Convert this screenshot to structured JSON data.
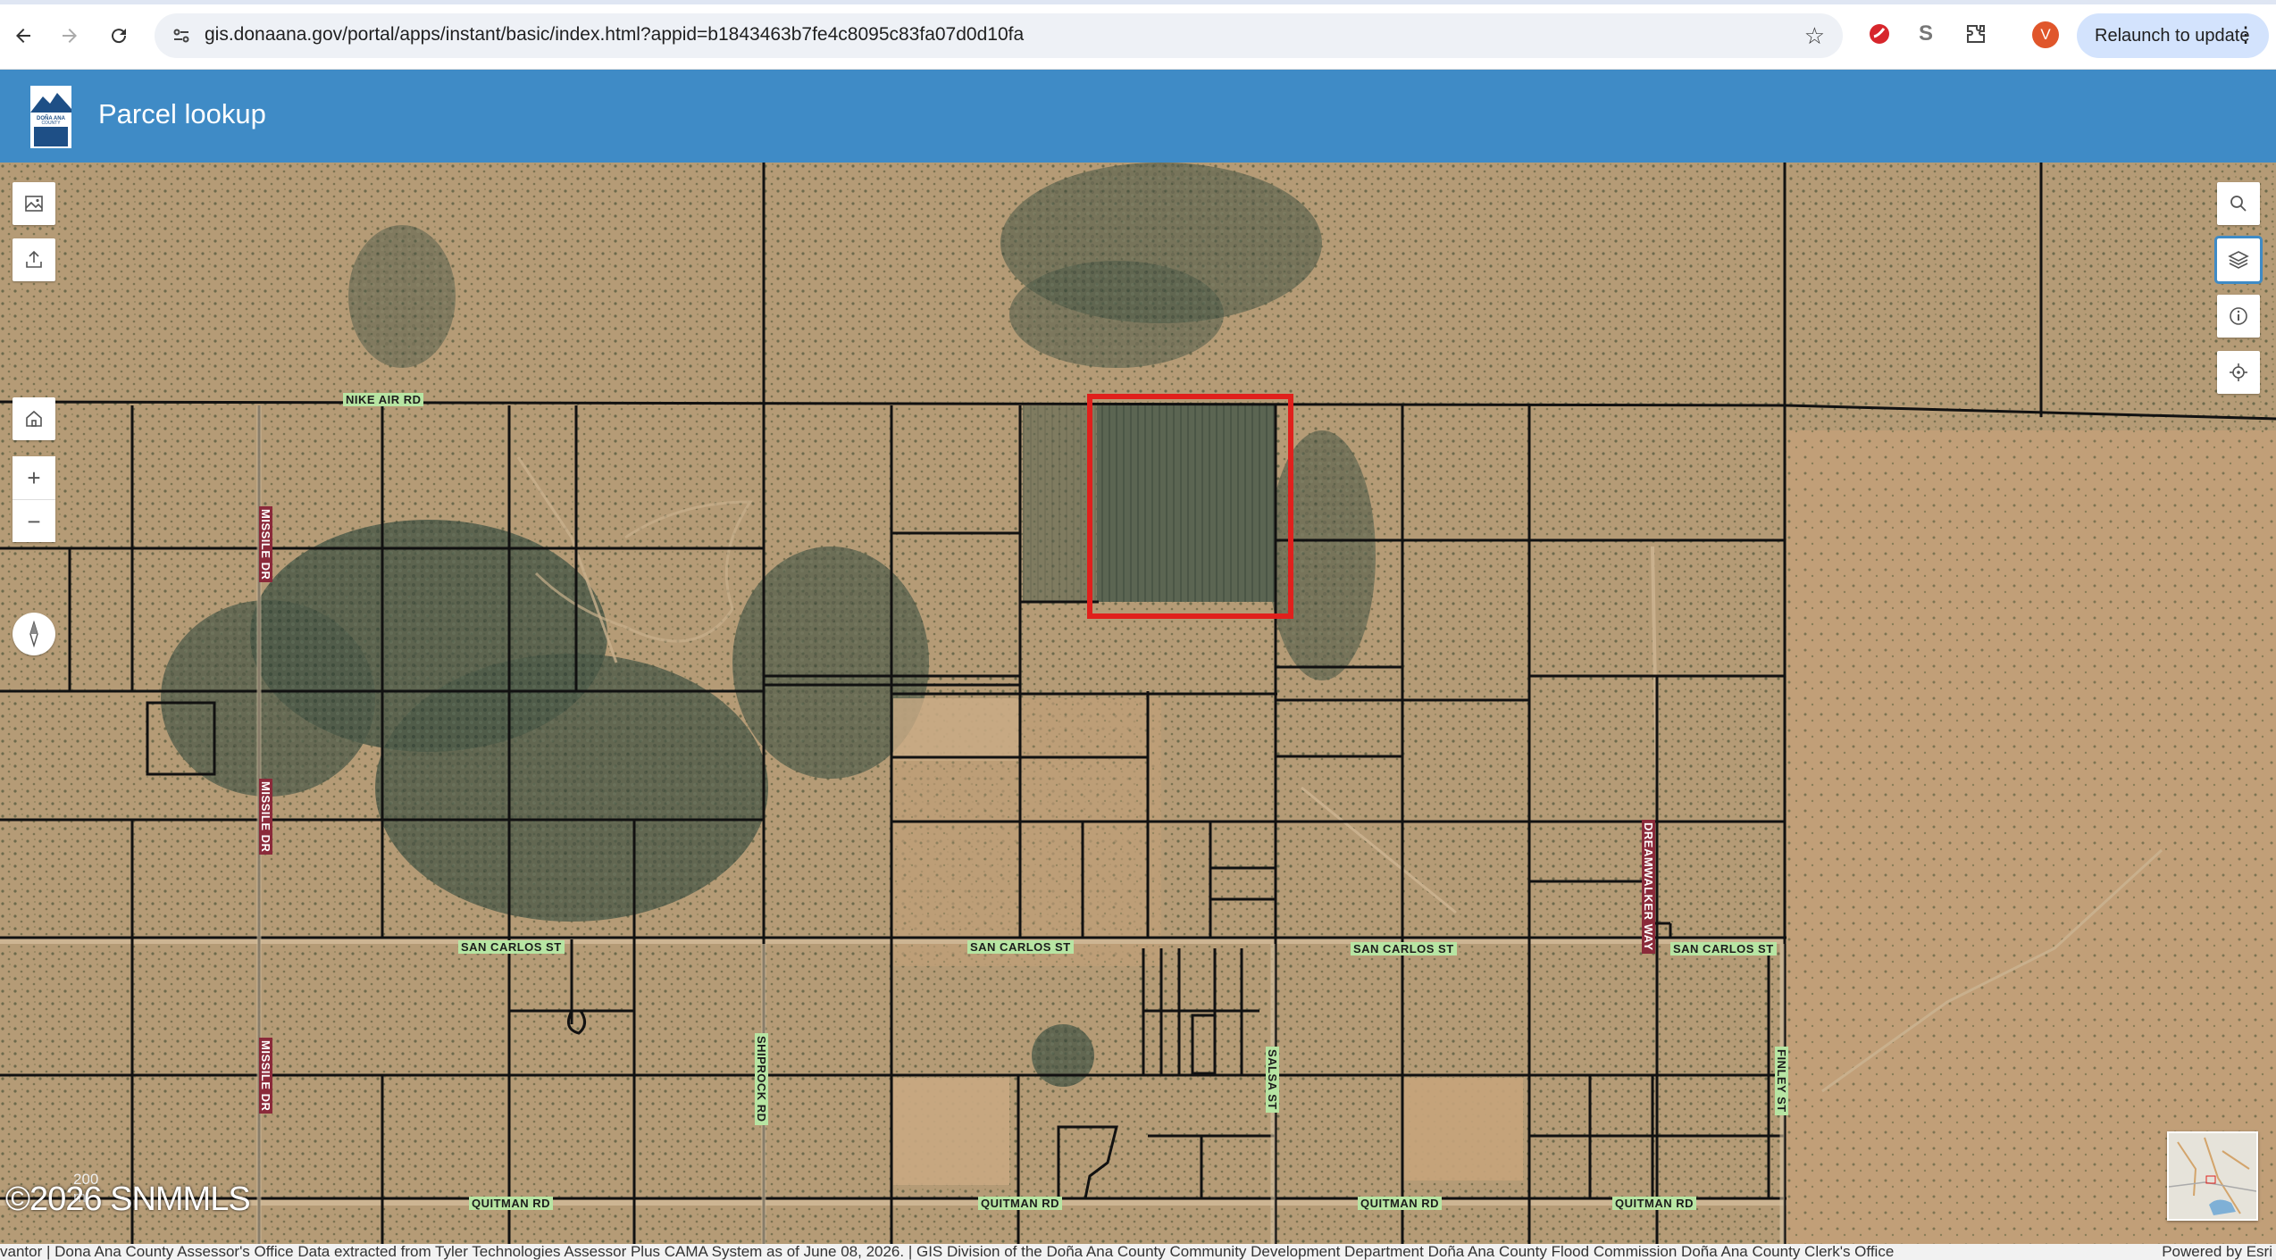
{
  "browser": {
    "url": "gis.donaana.gov/portal/apps/instant/basic/index.html?appid=b1843463b7fe4c8095c83fa07d0d10fa",
    "profile_initial": "V",
    "relaunch_label": "Relaunch to update",
    "icons": [
      "back-icon",
      "forward-icon",
      "reload-icon",
      "site-info-icon",
      "star-icon",
      "extensions-icon",
      "menu-icon"
    ]
  },
  "app": {
    "title": "Parcel lookup",
    "logo_text": "DOÑA ANA COUNTY"
  },
  "map": {
    "tools_left": [
      "basemap-gallery-icon",
      "share-icon",
      "zoom-in-icon",
      "zoom-out-icon",
      "home-icon",
      "compass-icon"
    ],
    "tools_right": [
      "search-icon",
      "layers-icon",
      "info-icon",
      "locate-icon"
    ],
    "zoom_in": "+",
    "zoom_out": "−",
    "streets": {
      "nike_air": "NIKE AIR RD",
      "missile_1": "MISSILE DR",
      "missile_2": "MISSILE DR",
      "missile_3": "MISSILE DR",
      "san_carlos_1": "SAN CARLOS ST",
      "san_carlos_2": "SAN CARLOS ST",
      "san_carlos_3": "SAN CARLOS ST",
      "san_carlos_4": "SAN CARLOS ST",
      "dreamwalker": "DREAMWALKER WAY",
      "shiprock": "SHIPROCK RD",
      "salsa": "SALSA ST",
      "finley": "FINLEY ST",
      "quitman_1": "QUITMAN RD",
      "quitman_2": "QUITMAN RD",
      "quitman_3": "QUITMAN RD",
      "quitman_4": "QUITMAN RD"
    },
    "scale_label": "200 m",
    "watermark": "©2026 SNMMLS",
    "highlight_color": "#e0201c"
  },
  "attribution": {
    "credits": "vantor | Dona Ana County Assessor's Office Data extracted from Tyler Technologies Assessor Plus CAMA System as of June 08, 2026. | GIS Division of the Doña Ana County Community Development Department Doña Ana County Flood Commission Doña Ana County Clerk's Office",
    "powered_by": "Powered by Esri"
  }
}
